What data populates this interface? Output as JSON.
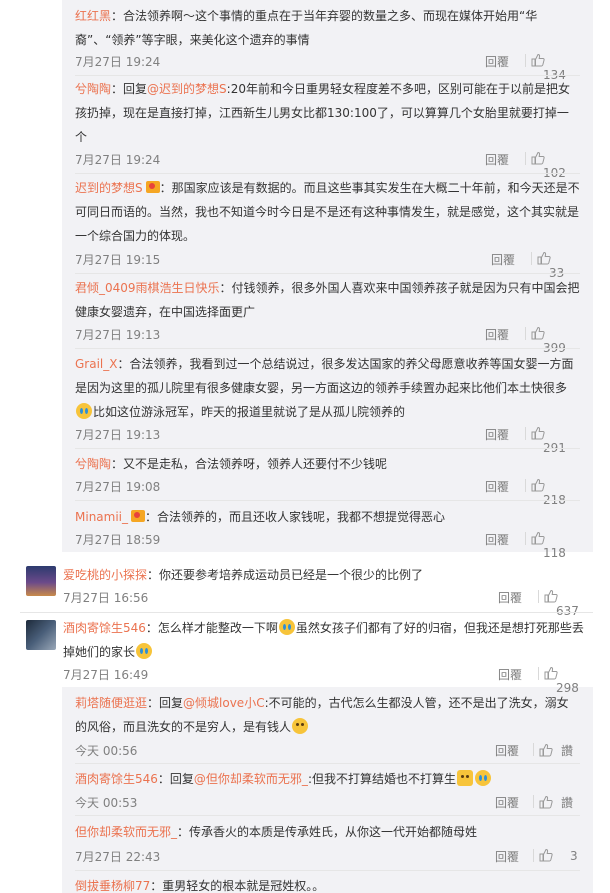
{
  "ui": {
    "reply_label": "回覆"
  },
  "comments": [
    {
      "name": "红红黑",
      "text": "：合法领养啊～这个事情的重点在于当年弃婴的数量之多、而现在媒体开始用“华裔”、“领养”等字眼，来美化这个遗弃的事情",
      "time": "7月27日 19:24",
      "likes": "134"
    },
    {
      "name": "兮陶陶",
      "reply_prefix": "：回复",
      "reply_to": "@迟到的梦想S",
      "text": ":20年前和今日重男轻女程度差不多吧，区别可能在于以前是把女孩扔掉，现在是直接打掉，江西新生儿男女比都130:100了，可以算算几个女胎里就要打掉一个",
      "time": "7月27日 19:24",
      "likes": "102"
    },
    {
      "name": "迟到的梦想S",
      "text": "：那国家应该是有数据的。而且这些事其实发生在大概二十年前，和今天还是不可同日而语的。当然，我也不知道今时今日是不是还有这种事情发生，就是感觉，这个其实就是一个综合国力的体现。",
      "time": "7月27日 19:15",
      "likes": "33"
    },
    {
      "name": "君倾_0409雨棋浩生日快乐",
      "text": "：付钱领养，很多外国人喜欢来中国领养孩子就是因为只有中国会把健康女婴遗弃，在中国选择面更广",
      "time": "7月27日 19:13",
      "likes": "399"
    },
    {
      "name": "Grail_X",
      "text": "：合法领养，我看到过一个总结说过，很多发达国家的养父母愿意收养等国女婴一方面是因为这里的孤儿院里有很多健康女婴，另一方面这边的领养手续置办起来比他们本土快很多",
      "text2": "比如这位游泳冠军，昨天的报道里就说了是从孤儿院领养的",
      "time": "7月27日 19:13",
      "likes": "291"
    },
    {
      "name": "兮陶陶",
      "text": "：又不是走私，合法领养呀，领养人还要付不少钱呢",
      "time": "7月27日 19:08",
      "likes": "218"
    },
    {
      "name": "Minamii_",
      "text": "：合法领养的，而且还收人家钱呢，我都不想提觉得恶心",
      "time": "7月27日 18:59",
      "likes": "118"
    },
    {
      "name": "爱吃桃的小探探",
      "text": "：你还要参考培养成运动员已经是一个很少的比例了",
      "time": "7月27日 16:56",
      "likes": "637"
    },
    {
      "name": "酒肉寄馀生546",
      "text": "：怎么样才能整改一下啊",
      "text2": "虽然女孩子们都有了好的归宿，但我还是想打死那些丢掉她们的家长",
      "time": "7月27日 16:49",
      "likes": "298"
    },
    {
      "name": "莉塔随便逛逛",
      "reply_prefix": "：回复",
      "reply_to": "@倾城love小C",
      "text": ":不可能的，古代怎么生都没人管，还不是出了洗女，溺女的风俗，而且洗女的不是穷人，是有钱人",
      "time": "今天 00:56",
      "likes": "讚"
    },
    {
      "name": "酒肉寄馀生546",
      "reply_prefix": "：回复",
      "reply_to": "@但你却柔软而无邪_",
      "text": ":但我不打算结婚也不打算生",
      "time": "今天 00:53",
      "likes": "讚"
    },
    {
      "name": "但你却柔软而无邪_",
      "text": "：传承香火的本质是传承姓氏，从你这一代开始都随母姓",
      "time": "7月27日 22:43",
      "likes": "3"
    },
    {
      "name": "倒拔垂杨柳77",
      "text": "：重男轻女的根本就是冠姓权。。",
      "time": "",
      "likes": ""
    }
  ],
  "colors": {
    "name": "#eb7350",
    "meta": "#808080",
    "reply_bg": "#f2f2f5",
    "divider": "#e6e6e6"
  }
}
